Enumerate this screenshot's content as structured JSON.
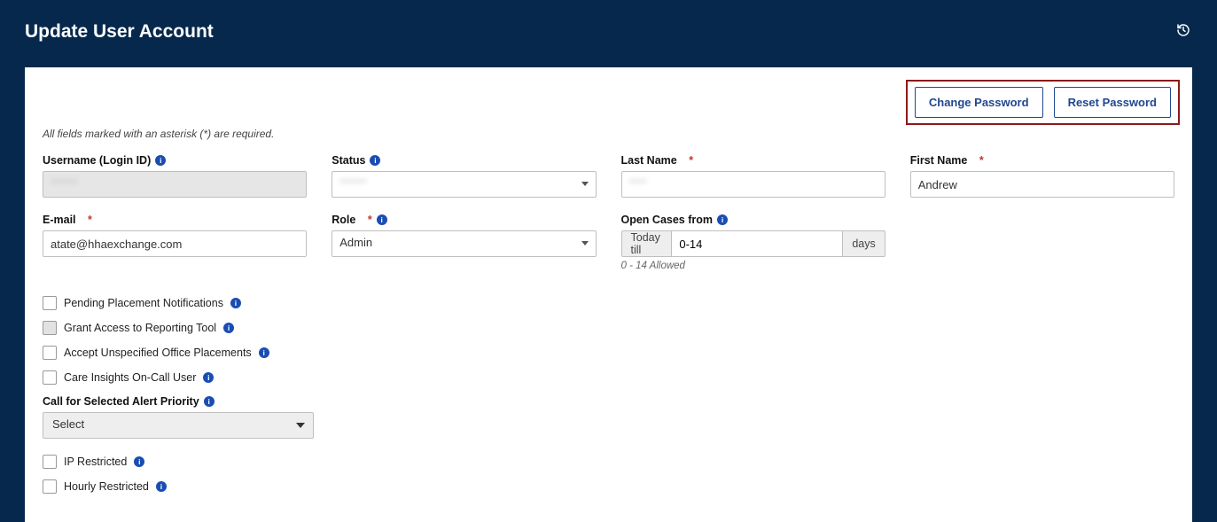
{
  "header": {
    "title": "Update User Account"
  },
  "actions": {
    "change_password": "Change Password",
    "reset_password": "Reset Password"
  },
  "note": "All fields marked with an asterisk (*) are required.",
  "fields": {
    "username": {
      "label": "Username (Login ID)",
      "value": "******"
    },
    "status": {
      "label": "Status",
      "value": "******"
    },
    "lastname": {
      "label": "Last Name",
      "value": "****"
    },
    "firstname": {
      "label": "First Name",
      "value": "Andrew"
    },
    "email": {
      "label": "E-mail",
      "value": "atate@hhaexchange.com"
    },
    "role": {
      "label": "Role",
      "value": "Admin"
    },
    "open_cases": {
      "label": "Open Cases from",
      "prefix": "Today till",
      "value": "0-14",
      "suffix": "days",
      "hint": "0 - 14 Allowed"
    }
  },
  "checkboxes": {
    "pending_placement": "Pending Placement Notifications",
    "grant_reporting": "Grant Access to Reporting Tool",
    "accept_unspecified": "Accept Unspecified Office Placements",
    "care_insights": "Care Insights On-Call User",
    "alert_priority_label": "Call for Selected Alert Priority",
    "alert_priority_value": "Select",
    "ip_restricted": "IP Restricted",
    "hourly_restricted": "Hourly Restricted"
  }
}
